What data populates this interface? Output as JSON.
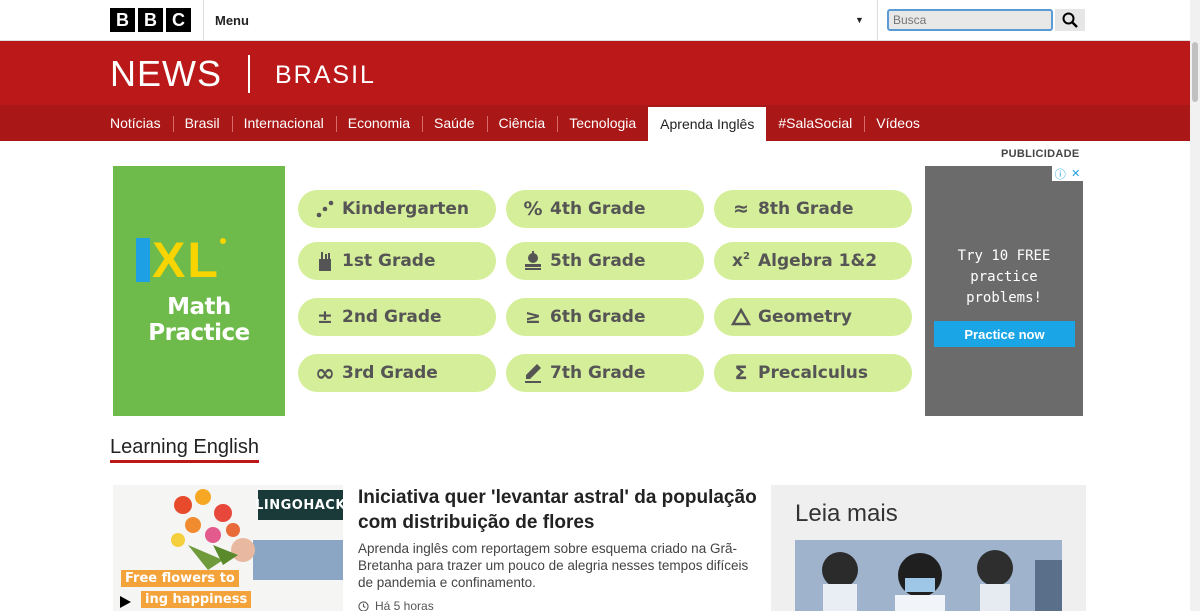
{
  "topbar": {
    "logo_letters": [
      "B",
      "B",
      "C"
    ],
    "menu_label": "Menu",
    "search_placeholder": "Busca"
  },
  "header": {
    "news": "NEWS",
    "edition": "BRASIL"
  },
  "nav": {
    "items": [
      {
        "label": "Notícias"
      },
      {
        "label": "Brasil"
      },
      {
        "label": "Internacional"
      },
      {
        "label": "Economia"
      },
      {
        "label": "Saúde"
      },
      {
        "label": "Ciência"
      },
      {
        "label": "Tecnologia"
      },
      {
        "label": "Aprenda Inglês",
        "active": true
      },
      {
        "label": "#SalaSocial"
      },
      {
        "label": "Vídeos"
      }
    ]
  },
  "ad": {
    "label": "PUBLICIDADE",
    "brand": "IXL",
    "tagline": "Math Practice",
    "grades": [
      {
        "label": "Kindergarten",
        "icon": "dots-icon"
      },
      {
        "label": "1st Grade",
        "icon": "pencil-cup-icon"
      },
      {
        "label": "2nd Grade",
        "icon": "plus-minus-icon"
      },
      {
        "label": "3rd Grade",
        "icon": "infinity-icon"
      },
      {
        "label": "4th Grade",
        "icon": "percent-icon"
      },
      {
        "label": "5th Grade",
        "icon": "apple-book-icon"
      },
      {
        "label": "6th Grade",
        "icon": "greater-equal-icon"
      },
      {
        "label": "7th Grade",
        "icon": "pencil-icon"
      },
      {
        "label": "8th Grade",
        "icon": "approx-icon"
      },
      {
        "label": "Algebra 1&2",
        "icon": "x-squared-icon"
      },
      {
        "label": "Geometry",
        "icon": "triangle-icon"
      },
      {
        "label": "Precalculus",
        "icon": "sigma-icon"
      }
    ],
    "side_line1": "Try 10 FREE",
    "side_line2": "practice",
    "side_line3": "problems!",
    "cta": "Practice now",
    "colors": {
      "green": "#6ebb4b",
      "pill": "#d5ee99",
      "cta": "#1aa5e6",
      "side": "#6b6b6b"
    }
  },
  "section": {
    "title": "Learning English"
  },
  "article": {
    "thumb_badge": "LINGOHACK",
    "thumb_caption_1": "Free flowers to",
    "thumb_caption_2": "ing happiness",
    "headline": "Iniciativa quer 'levantar astral' da população com distribuição de flores",
    "summary": "Aprenda inglês com reportagem sobre esquema criado na Grã-Bretanha para trazer um pouco de alegria nesses tempos difíceis de pandemia e confinamento.",
    "timestamp": "Há 5 horas"
  },
  "sidebar": {
    "title": "Leia mais"
  },
  "colors": {
    "brand_red": "#bb1919",
    "nav_red": "#a91717"
  }
}
